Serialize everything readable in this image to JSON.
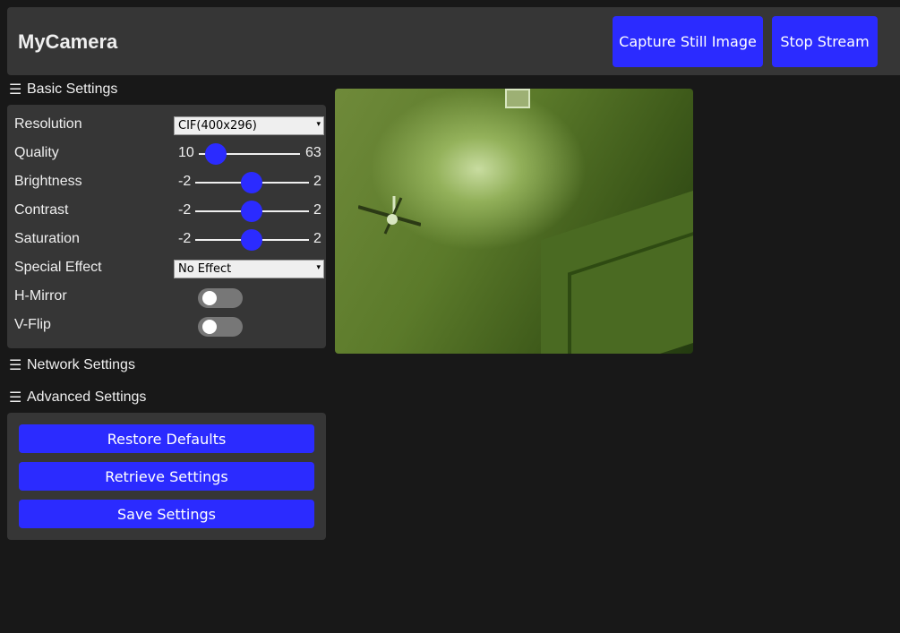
{
  "header": {
    "title": "MyCamera",
    "capture_label": "Capture Still Image",
    "stream_label": "Stop Stream"
  },
  "sections": {
    "basic": "Basic Settings",
    "network": "Network Settings",
    "advanced": "Advanced Settings"
  },
  "basic": {
    "resolution": {
      "label": "Resolution",
      "value": "CIF(400x296)"
    },
    "quality": {
      "label": "Quality",
      "min": "10",
      "max": "63",
      "value": 10
    },
    "brightness": {
      "label": "Brightness",
      "min": "-2",
      "max": "2",
      "value": 0
    },
    "contrast": {
      "label": "Contrast",
      "min": "-2",
      "max": "2",
      "value": 0
    },
    "saturation": {
      "label": "Saturation",
      "min": "-2",
      "max": "2",
      "value": 0
    },
    "special_effect": {
      "label": "Special Effect",
      "value": "No Effect"
    },
    "hmirror": {
      "label": "H-Mirror",
      "on": false
    },
    "vflip": {
      "label": "V-Flip",
      "on": false
    }
  },
  "advanced": {
    "restore_label": "Restore Defaults",
    "retrieve_label": "Retrieve Settings",
    "save_label": "Save Settings"
  },
  "colors": {
    "accent": "#2b2bff",
    "panel": "#363636",
    "background": "#181818"
  }
}
